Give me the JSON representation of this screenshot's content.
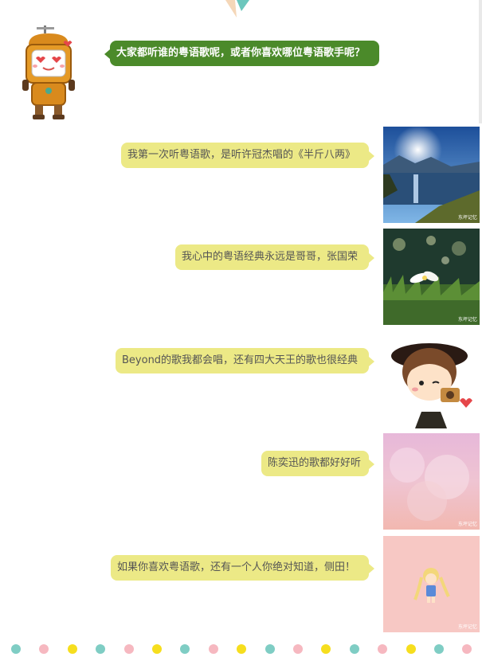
{
  "question": "大家都听谁的粤语歌呢，或者你喜欢哪位粤语歌手呢？",
  "messages": [
    {
      "text": "我第一次听粤语歌，是听许冠杰唱的《半斤八两》",
      "image": "lake-landscape"
    },
    {
      "text": "我心中的粤语经典永远是哥哥，张国荣",
      "image": "flower-bokeh"
    },
    {
      "text": "Beyond的歌我都会唱，还有四大天王的歌也很经典",
      "image": "cartoon-boy-camera"
    },
    {
      "text": "陈奕迅的歌都好好听",
      "image": "pink-clouds"
    },
    {
      "text": "如果你喜欢粤语歌，还有一个人你绝对知道，侧田！",
      "image": "anime-girl-pink"
    }
  ],
  "watermark": "东坪记忆",
  "colors": {
    "question_bubble": "#4b8a2a",
    "answer_bubble": "#ece986",
    "dot_teal": "#7fcdc4",
    "dot_pink": "#f6b8c0",
    "dot_yellow": "#f6de1e"
  }
}
